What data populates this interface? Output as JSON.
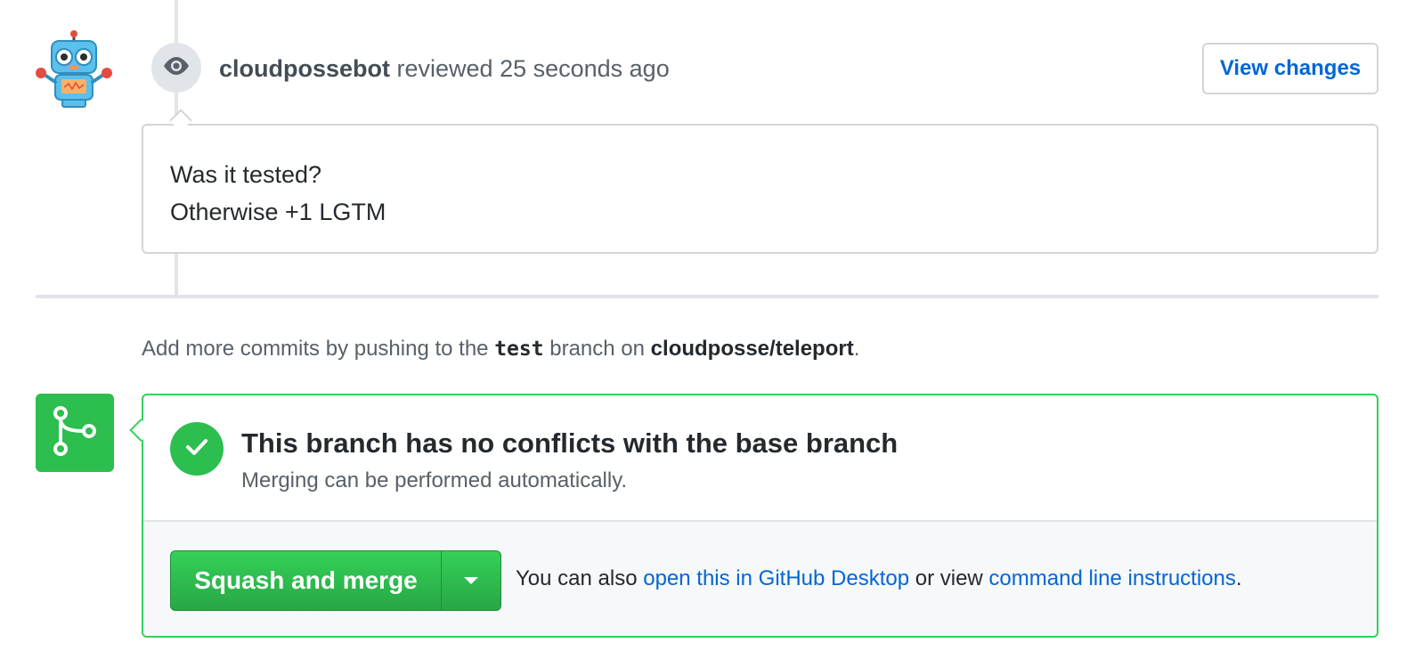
{
  "review": {
    "author": "cloudpossebot",
    "action_text": " reviewed 25 seconds ago",
    "view_changes_label": "View changes",
    "comment_lines": [
      "Was it tested?",
      "Otherwise +1 LGTM"
    ]
  },
  "push_hint": {
    "prefix": "Add more commits by pushing to the ",
    "branch": "test",
    "middle": " branch on ",
    "repo": "cloudposse/teleport",
    "suffix": "."
  },
  "merge": {
    "status_title": "This branch has no conflicts with the base branch",
    "status_subtitle": "Merging can be performed automatically.",
    "button_label": "Squash and merge",
    "alt_prefix": "You can also ",
    "desktop_link": "open this in GitHub Desktop",
    "alt_middle": " or view ",
    "cli_link": "command line instructions",
    "alt_suffix": "."
  },
  "icons": {
    "avatar": "robot-avatar",
    "review_badge": "eye-icon",
    "merge_badge": "git-branch-icon",
    "status": "check-icon",
    "dropdown": "caret-down-icon"
  },
  "colors": {
    "link": "#0366d6",
    "success": "#2cbe4e",
    "border": "#d1d5da",
    "timeline": "#e1e4e8"
  }
}
